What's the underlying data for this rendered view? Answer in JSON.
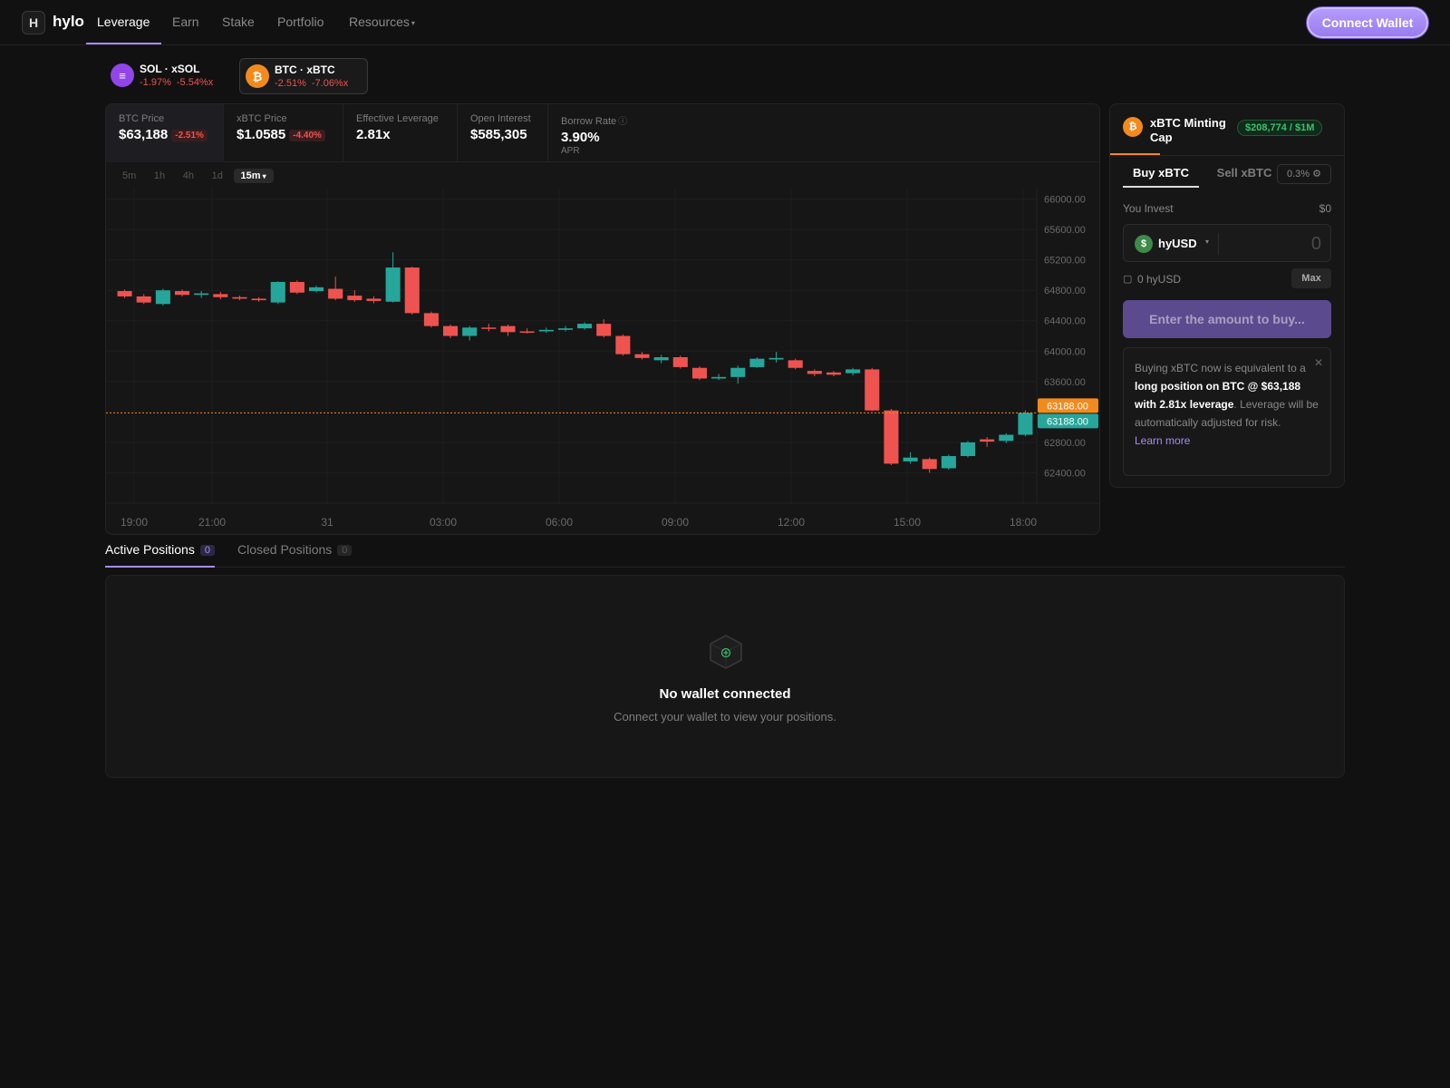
{
  "nav": {
    "logo_letter": "H",
    "brand": "hylo",
    "items": [
      {
        "label": "Leverage",
        "active": true
      },
      {
        "label": "Earn",
        "active": false
      },
      {
        "label": "Stake",
        "active": false
      },
      {
        "label": "Portfolio",
        "active": false
      },
      {
        "label": "Resources",
        "active": false,
        "icon": "chevron-down-icon"
      }
    ],
    "connect_label": "Connect Wallet"
  },
  "markets": [
    {
      "name": "SOL · xSOL",
      "change_1": "-1.97%",
      "change_2": "-5.54%x",
      "icon": "sol-icon",
      "selected": false
    },
    {
      "name": "BTC · xBTC",
      "change_1": "-2.51%",
      "change_2": "-7.06%x",
      "icon": "btc-icon",
      "selected": true
    }
  ],
  "stats": {
    "btc_price": {
      "label": "BTC Price",
      "value": "$63,188",
      "badge": "-2.51%"
    },
    "xbtc_price": {
      "label": "xBTC Price",
      "value": "$1.0585",
      "badge": "-4.40%"
    },
    "leverage": {
      "label": "Effective Leverage",
      "value": "2.81x"
    },
    "open_interest": {
      "label": "Open Interest",
      "value": "$585,305"
    },
    "borrow_rate": {
      "label": "Borrow Rate",
      "value": "3.90%",
      "sub": "APR",
      "icon": "info-icon"
    }
  },
  "timeframes": [
    "5m",
    "1h",
    "4h",
    "1d",
    "15m"
  ],
  "active_timeframe": "15m",
  "chart_data": {
    "type": "candlestick",
    "interval": "15m",
    "x_tick_labels": [
      "19:00",
      "21:00",
      "31",
      "03:00",
      "06:00",
      "09:00",
      "12:00",
      "15:00",
      "18:00"
    ],
    "y_tick_labels": [
      "66000.00",
      "65600.00",
      "65200.00",
      "64800.00",
      "64400.00",
      "64000.00",
      "63600.00",
      "62800.00",
      "62400.00"
    ],
    "ylim": [
      62000,
      66150
    ],
    "last_price_labels": [
      "63188.00",
      "63188.00"
    ],
    "last_price": 63188,
    "candles": [
      [
        64790,
        64720,
        64810,
        64700
      ],
      [
        64720,
        64640,
        64750,
        64620
      ],
      [
        64620,
        64800,
        64820,
        64600
      ],
      [
        64790,
        64740,
        64810,
        64720
      ],
      [
        64740,
        64760,
        64790,
        64700
      ],
      [
        64750,
        64710,
        64780,
        64680
      ],
      [
        64710,
        64690,
        64730,
        64670
      ],
      [
        64690,
        64670,
        64710,
        64650
      ],
      [
        64640,
        64910,
        64920,
        64620
      ],
      [
        64910,
        64770,
        64930,
        64750
      ],
      [
        64790,
        64840,
        64860,
        64770
      ],
      [
        64820,
        64690,
        64980,
        64670
      ],
      [
        64730,
        64670,
        64800,
        64650
      ],
      [
        64690,
        64660,
        64720,
        64630
      ],
      [
        64650,
        65100,
        65300,
        64640
      ],
      [
        65100,
        64500,
        65110,
        64480
      ],
      [
        64500,
        64330,
        64520,
        64310
      ],
      [
        64330,
        64200,
        64350,
        64170
      ],
      [
        64200,
        64310,
        64330,
        64140
      ],
      [
        64310,
        64300,
        64360,
        64260
      ],
      [
        64330,
        64250,
        64350,
        64200
      ],
      [
        64260,
        64250,
        64300,
        64230
      ],
      [
        64260,
        64280,
        64310,
        64240
      ],
      [
        64280,
        64300,
        64330,
        64260
      ],
      [
        64300,
        64360,
        64380,
        64280
      ],
      [
        64360,
        64200,
        64420,
        64180
      ],
      [
        64200,
        63960,
        64220,
        63940
      ],
      [
        63960,
        63910,
        63990,
        63890
      ],
      [
        63880,
        63920,
        63950,
        63840
      ],
      [
        63920,
        63790,
        63940,
        63770
      ],
      [
        63780,
        63640,
        63800,
        63620
      ],
      [
        63640,
        63660,
        63700,
        63620
      ],
      [
        63660,
        63780,
        63810,
        63570
      ],
      [
        63790,
        63900,
        63920,
        63780
      ],
      [
        63890,
        63910,
        63990,
        63850
      ],
      [
        63880,
        63780,
        63900,
        63760
      ],
      [
        63740,
        63700,
        63760,
        63670
      ],
      [
        63720,
        63690,
        63740,
        63670
      ],
      [
        63710,
        63760,
        63780,
        63680
      ],
      [
        63760,
        63220,
        63780,
        63210
      ],
      [
        63220,
        62520,
        63240,
        62500
      ],
      [
        62550,
        62600,
        62670,
        62520
      ],
      [
        62580,
        62450,
        62600,
        62400
      ],
      [
        62460,
        62620,
        62640,
        62440
      ],
      [
        62620,
        62800,
        62820,
        62600
      ],
      [
        62840,
        62810,
        62870,
        62740
      ],
      [
        62820,
        62900,
        62920,
        62790
      ],
      [
        62900,
        63188,
        63220,
        62880
      ]
    ]
  },
  "trade": {
    "coin_icon": "btc-icon",
    "cap_title": "xBTC Minting Cap",
    "cap_badge": "$208,774 / $1M",
    "buy_tab": "Buy xBTC",
    "sell_tab": "Sell xBTC",
    "slippage": "0.3%",
    "slippage_icon": "gear-icon",
    "invest_label": "You Invest",
    "invest_usd": "$0",
    "token": "hyUSD",
    "amount_placeholder": "0",
    "balance": "0  hyUSD",
    "max_label": "Max",
    "cta_label": "Enter the amount to buy...",
    "notice_1": "Buying xBTC now is equivalent to a ",
    "notice_bold": "long position on BTC @ $63,188 with 2.81x leverage",
    "notice_2": ". Leverage will be automatically adjusted for risk.",
    "learn_more": "Learn more",
    "close_glyph": "✕"
  },
  "positions": {
    "active_tab": "Active Positions",
    "active_count": "0",
    "closed_tab": "Closed Positions",
    "closed_count": "0",
    "empty_title": "No wallet connected",
    "empty_subtitle": "Connect your wallet to view your positions.",
    "empty_icon": "cube-icon"
  },
  "colors": {
    "accent": "#a68cf5",
    "up": "#26a69a",
    "down": "#ef5350",
    "btc": "#f28a1e"
  }
}
